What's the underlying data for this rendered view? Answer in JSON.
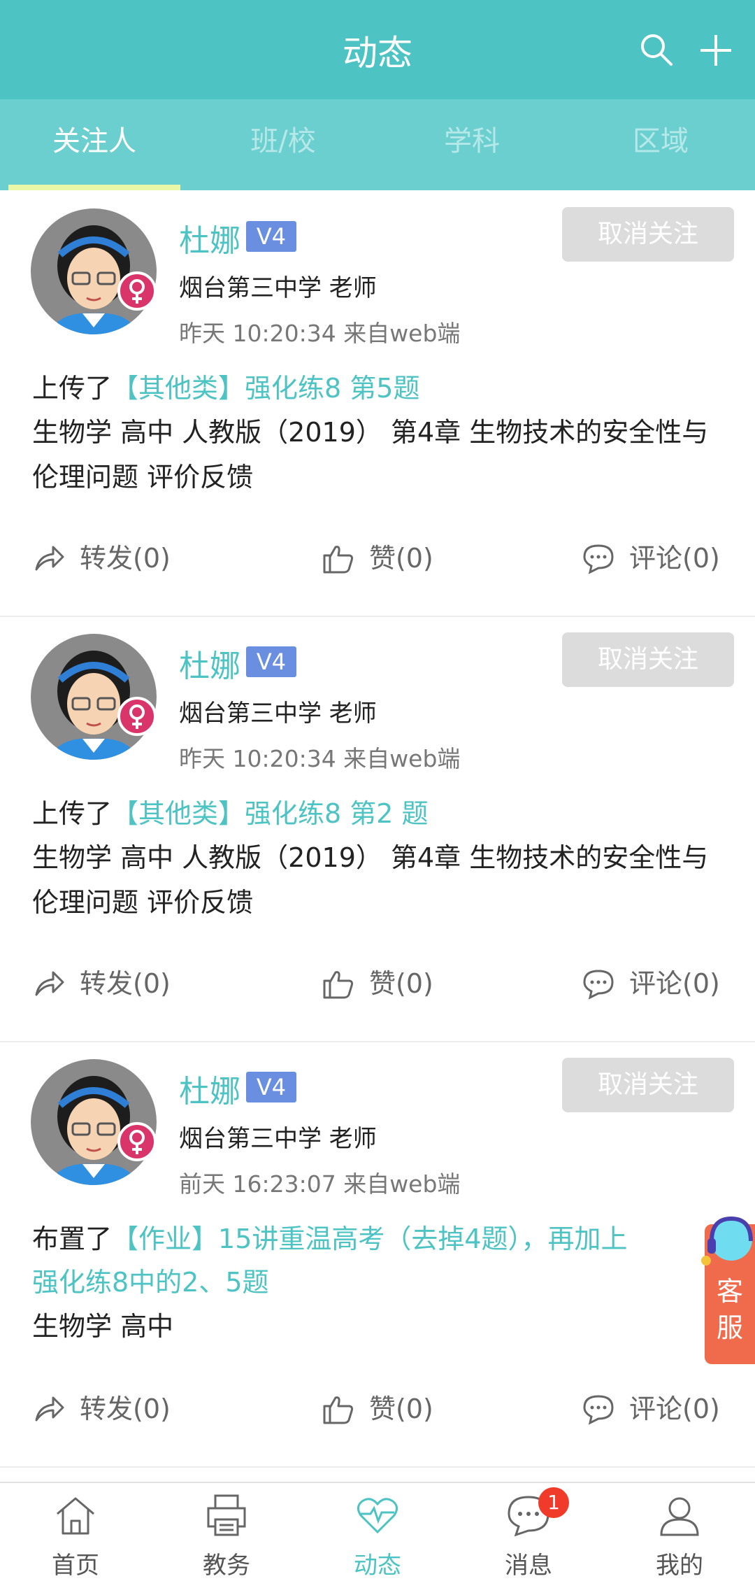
{
  "header": {
    "title": "动态",
    "search_icon": "search-icon",
    "add_icon": "plus-icon",
    "bg_color": "#4dc3c3"
  },
  "tabs": [
    {
      "label": "关注人",
      "active": true
    },
    {
      "label": "班/校",
      "active": false
    },
    {
      "label": "学科",
      "active": false
    },
    {
      "label": "区域",
      "active": false
    }
  ],
  "posts": [
    {
      "name": "杜娜",
      "level": "V4",
      "org": "烟台第三中学 老师",
      "meta": "昨天 10:20:34 来自web端",
      "follow_button": "取消关注",
      "verb": "上传了",
      "link": "【其他类】强化练8 第5题",
      "link_line2": "",
      "detail": "生物学 高中 人教版（2019） 第4章 生物技术的安全性与伦理问题 评价反馈",
      "forward": "转发(0)",
      "like": "赞(0)",
      "comment": "评论(0)"
    },
    {
      "name": "杜娜",
      "level": "V4",
      "org": "烟台第三中学 老师",
      "meta": "昨天 10:20:34 来自web端",
      "follow_button": "取消关注",
      "verb": "上传了",
      "link": "【其他类】强化练8 第2 题",
      "link_line2": "",
      "detail": "生物学 高中 人教版（2019） 第4章 生物技术的安全性与伦理问题 评价反馈",
      "forward": "转发(0)",
      "like": "赞(0)",
      "comment": "评论(0)"
    },
    {
      "name": "杜娜",
      "level": "V4",
      "org": "烟台第三中学 老师",
      "meta": "前天 16:23:07 来自web端",
      "follow_button": "取消关注",
      "verb": "布置了",
      "link": "【作业】15讲重温高考（去掉4题），再加上",
      "link_line2": "强化练8中的2、5题",
      "detail": "生物学 高中",
      "forward": "转发(0)",
      "like": "赞(0)",
      "comment": "评论(0)"
    }
  ],
  "service": {
    "label": "客服"
  },
  "bottom_nav": [
    {
      "label": "首页",
      "icon": "home-icon",
      "active": false,
      "badge": ""
    },
    {
      "label": "教务",
      "icon": "printer-icon",
      "active": false,
      "badge": ""
    },
    {
      "label": "动态",
      "icon": "heartbeat-icon",
      "active": true,
      "badge": ""
    },
    {
      "label": "消息",
      "icon": "chat-icon",
      "active": false,
      "badge": "1"
    },
    {
      "label": "我的",
      "icon": "user-icon",
      "active": false,
      "badge": ""
    }
  ]
}
